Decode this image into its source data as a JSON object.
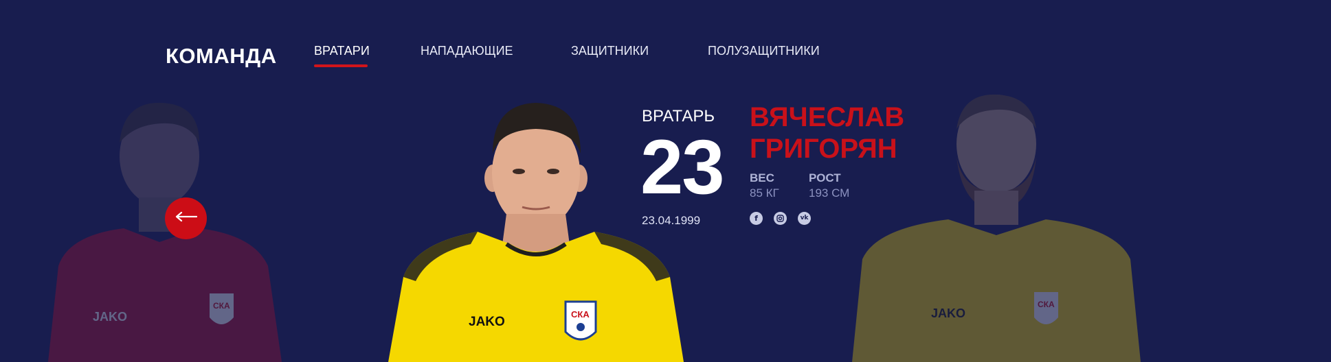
{
  "header": {
    "brand": "КОМАНДА",
    "tabs": [
      {
        "label": "ВРАТАРИ",
        "active": true
      },
      {
        "label": "НАПАДАЮЩИЕ",
        "active": false
      },
      {
        "label": "ЗАЩИТНИКИ",
        "active": false
      },
      {
        "label": "ПОЛУЗАЩИТНИКИ",
        "active": false
      }
    ]
  },
  "player": {
    "role": "ВРАТАРЬ",
    "number": "23",
    "birth_date": "23.04.1999",
    "name_line1": "ВЯЧЕСЛАВ",
    "name_line2": "ГРИГОРЯН",
    "weight_label": "ВЕС",
    "weight_value": "85 КГ",
    "height_label": "РОСТ",
    "height_value": "193 СМ",
    "socials": [
      "facebook-icon",
      "instagram-icon",
      "vk-icon"
    ]
  },
  "jerseys": {
    "left_brand": "JAKO",
    "left_club": "СКА",
    "center_brand": "JAKO",
    "center_club": "СКА",
    "right_brand": "JAKO",
    "right_club": "СКА"
  },
  "colors": {
    "background": "#181d4f",
    "accent": "#d1141b",
    "name": "#c9111a",
    "jersey_yellow": "#f5d800",
    "jersey_red": "#b0102c"
  },
  "controls": {
    "prev_arrow": "←"
  }
}
